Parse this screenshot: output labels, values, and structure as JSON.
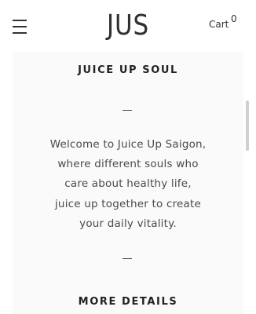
{
  "header": {
    "logo_text": "JUS",
    "cart_label": "Cart",
    "cart_count": "0"
  },
  "intro": {
    "title": "JUICE UP SOUL",
    "lines": [
      "Welcome to Juice Up Saigon,",
      "where different souls who",
      "care about healthy life,",
      "juice up together to create",
      "your daily vitality."
    ]
  },
  "details": {
    "title": "MORE DETAILS"
  },
  "icons": {
    "menu": "hamburger-menu-icon"
  }
}
